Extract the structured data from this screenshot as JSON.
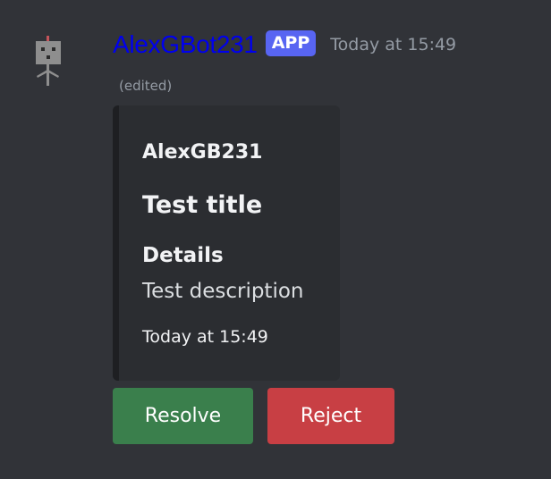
{
  "message": {
    "author": "AlexGBot231",
    "badge": "APP",
    "timestamp": "Today at 15:49",
    "edited": "(edited)",
    "avatar_icon": "robot-icon"
  },
  "embed": {
    "author": "AlexGB231",
    "title": "Test title",
    "field_name": "Details",
    "field_value": "Test description",
    "footer": "Today at 15:49"
  },
  "buttons": {
    "resolve_label": "Resolve",
    "reject_label": "Reject"
  },
  "colors": {
    "background": "#313338",
    "embed_background": "#2b2d31",
    "username_link": "#0000ee",
    "app_badge": "#5865f2",
    "resolve_button": "#3a7f4c",
    "reject_button": "#c83f44"
  }
}
